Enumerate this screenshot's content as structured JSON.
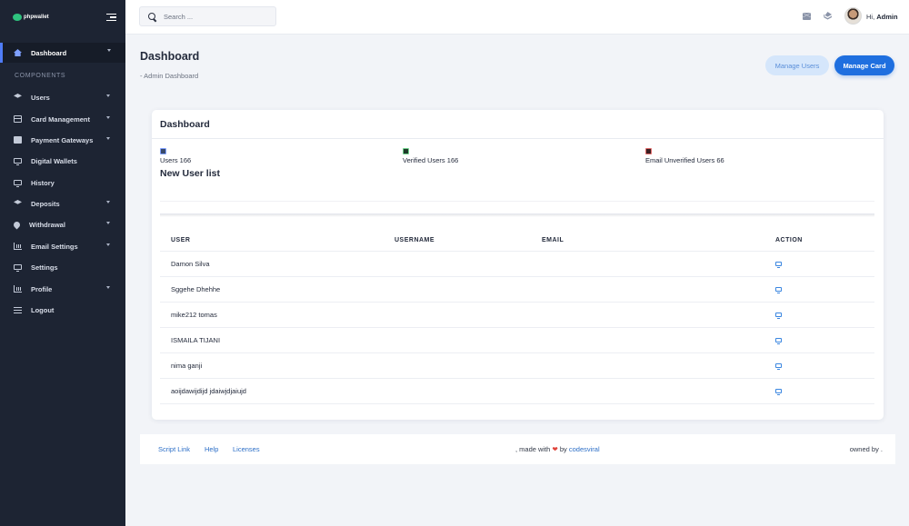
{
  "brand": {
    "name": "phpwallet"
  },
  "sidebar": {
    "active": {
      "label": "Dashboard",
      "icon": "home-icon"
    },
    "section_label": "COMPONENTS",
    "items": [
      {
        "label": "Users",
        "icon": "layers-icon",
        "has_submenu": true
      },
      {
        "label": "Card Management",
        "icon": "credit-card-icon",
        "has_submenu": true
      },
      {
        "label": "Payment Gateways",
        "icon": "edit-icon",
        "has_submenu": true
      },
      {
        "label": "Digital Wallets",
        "icon": "monitor-icon",
        "has_submenu": false
      },
      {
        "label": "History",
        "icon": "monitor-icon",
        "has_submenu": false
      },
      {
        "label": "Deposits",
        "icon": "layers-icon",
        "has_submenu": true
      },
      {
        "label": "Withdrawal",
        "icon": "pin-icon",
        "has_submenu": true
      },
      {
        "label": "Email Settings",
        "icon": "bar-chart-icon",
        "has_submenu": true
      },
      {
        "label": "Settings",
        "icon": "monitor-icon",
        "has_submenu": false
      },
      {
        "label": "Profile",
        "icon": "bar-chart-icon",
        "has_submenu": true
      },
      {
        "label": "Logout",
        "icon": "menu-icon",
        "has_submenu": false
      }
    ]
  },
  "topbar": {
    "search_placeholder": "Search ...",
    "greeting_prefix": "Hi,",
    "user_name": "Admin"
  },
  "header": {
    "title": "Dashboard",
    "breadcrumb": "- Admin Dashboard",
    "manage_users_label": "Manage Users",
    "manage_card_label": "Manage Card"
  },
  "card": {
    "title": "Dashboard",
    "stats": {
      "users": "Users 166",
      "verified": "Verified Users 166",
      "unverified": "Email Unverified Users 66"
    },
    "new_users_title": "New User list",
    "columns": [
      "USER",
      "USERNAME",
      "EMAIL",
      "ACTION"
    ],
    "rows": [
      {
        "user": "Damon Silva",
        "username": "",
        "email": ""
      },
      {
        "user": "Sggehe Dhehhe",
        "username": "",
        "email": ""
      },
      {
        "user": "mike212 tomas",
        "username": "",
        "email": ""
      },
      {
        "user": "ISMAILA TIJANI",
        "username": "",
        "email": ""
      },
      {
        "user": "nima ganji",
        "username": "",
        "email": ""
      },
      {
        "user": "aoijdawijdijd jdaiwjdjaiujd",
        "username": "",
        "email": ""
      }
    ]
  },
  "footer": {
    "links": [
      "Script Link",
      "Help",
      "Licenses"
    ],
    "made_with_prefix": ", made with",
    "made_with_by": "by",
    "author": "codesviral",
    "owned_by": "owned by ."
  },
  "colors": {
    "sidebar_bg": "#1d2433",
    "accent": "#1f6fdf",
    "accent_light": "#d5e6fb",
    "page_bg": "#f2f4f8"
  }
}
